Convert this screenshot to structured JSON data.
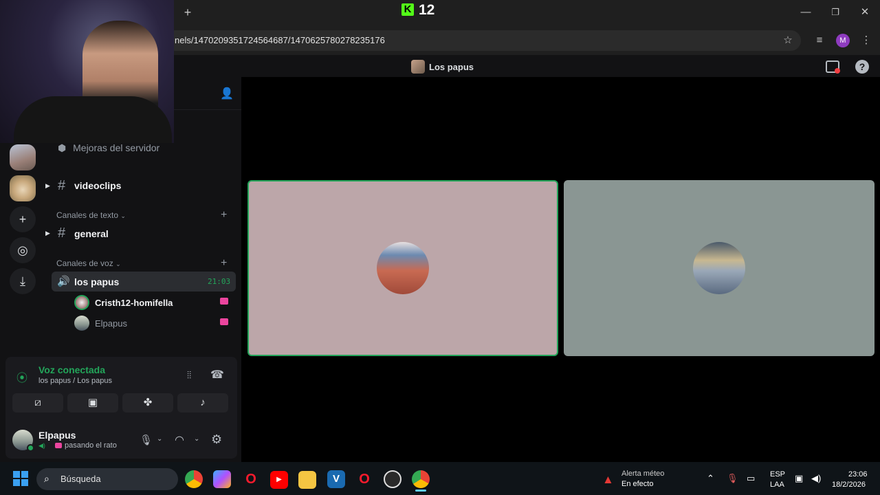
{
  "browser": {
    "url": "nels/1470209351724564687/1470625780278235176",
    "new_tab_label": "+",
    "window_controls": [
      "minimize-icon",
      "restore-icon",
      "close-icon"
    ],
    "profile_initial": "M",
    "kick_overlay_count": "12",
    "kick_logo_letter": "K"
  },
  "discord": {
    "top_title": "Los papus",
    "sidebar": {
      "boosts_label": "Mejoras del servidor",
      "channels_top": [
        {
          "name": "videoclips"
        }
      ],
      "text_category": "Canales de texto",
      "text_channels": [
        {
          "name": "general"
        }
      ],
      "voice_category": "Canales de voz",
      "voice_channels": [
        {
          "name": "los papus",
          "timer": "21:03"
        }
      ],
      "voice_members": [
        {
          "name": "Cristh12-homifella"
        },
        {
          "name": "Elpapus"
        }
      ]
    },
    "voice_panel": {
      "status": "Voz conectada",
      "location": "los papus / Los papus"
    },
    "user": {
      "name": "Elpapus",
      "status": "pasando el rato"
    }
  },
  "taskbar": {
    "search_placeholder": "Búsqueda",
    "weather_alert_title": "Alerta méteo",
    "weather_alert_sub": "En efecto",
    "lang_line1": "ESP",
    "lang_line2": "LAA",
    "time": "23:06",
    "date": "18/2/2026"
  },
  "colors": {
    "accent_green": "#23a55a",
    "sidebar_bg": "#121214",
    "kick_green": "#53fc18"
  }
}
